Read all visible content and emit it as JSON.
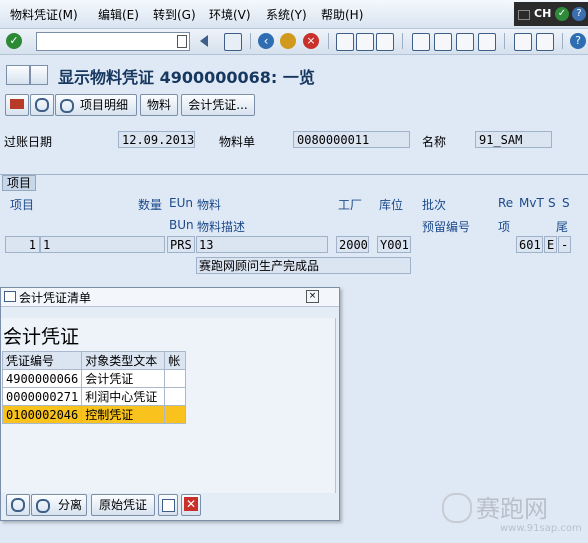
{
  "menu": {
    "items": [
      "物料凭证(M)",
      "编辑(E)",
      "转到(G)",
      "环境(V)",
      "系统(Y)",
      "帮助(H)"
    ],
    "lang": "CH"
  },
  "toolbar": {
    "command_value": ""
  },
  "title": {
    "text": "显示物料凭证 4900000068: 一览"
  },
  "app_toolbar": {
    "item_detail_label": "项目明细",
    "material_label": "物料",
    "acc_doc_label": "会计凭证..."
  },
  "header": {
    "posting_date_label": "过账日期",
    "posting_date_value": "12.09.2013",
    "material_slip_label": "物料单",
    "material_slip_value": "0080000011",
    "name_label": "名称",
    "name_value": "91_SAM"
  },
  "items": {
    "section_label": "项目",
    "headers_row1": {
      "item": "项目",
      "qty": "数量",
      "eun": "EUn",
      "material": "物料",
      "plant": "工厂",
      "sloc": "库位",
      "batch": "批次",
      "re": "Re",
      "mvt": "MvT",
      "s1": "S",
      "s2": "S"
    },
    "headers_row2": {
      "bun": "BUn",
      "desc": "物料描述",
      "reservation": "预留编号",
      "item2": "项",
      "tail": "尾"
    },
    "row": {
      "item": "1",
      "qty": "1",
      "unit": "PRS",
      "material": "13",
      "plant": "2000",
      "sloc": "Y001",
      "mvt": "601",
      "s": "E",
      "s2": "-",
      "description": "赛跑网顾问生产完成品"
    }
  },
  "dialog": {
    "title": "会计凭证清单",
    "heading": "会计凭证",
    "columns": [
      "凭证编号",
      "对象类型文本",
      "帐"
    ],
    "rows": [
      {
        "doc": "4900000066",
        "type": "会计凭证",
        "acc": ""
      },
      {
        "doc": "0000000271",
        "type": "利润中心凭证",
        "acc": ""
      },
      {
        "doc": "0100002046",
        "type": "控制凭证",
        "acc": ""
      }
    ],
    "buttons": {
      "split": "分离",
      "original": "原始凭证"
    }
  },
  "watermark": {
    "brand": "赛跑网",
    "url": "www.91sap.com"
  }
}
